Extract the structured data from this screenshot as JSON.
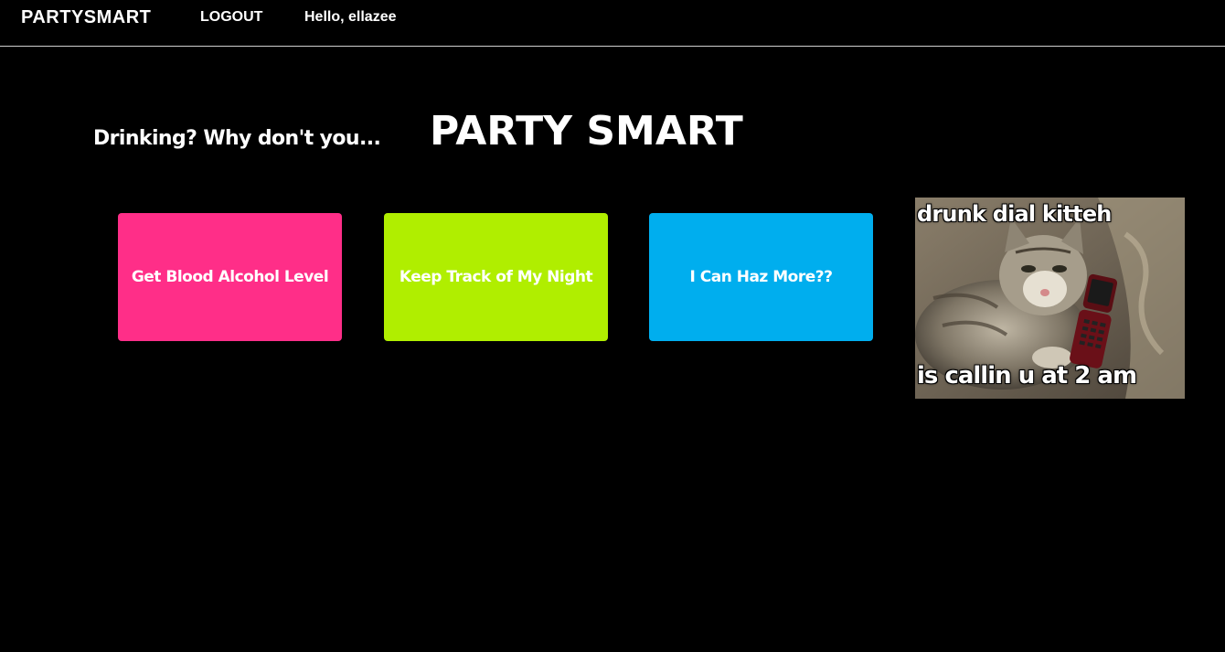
{
  "nav": {
    "brand": "PARTYSMART",
    "logout": "LOGOUT",
    "greeting": "Hello, ellazee"
  },
  "hero": {
    "tagline": "Drinking? Why don't you...",
    "title": "PARTY SMART"
  },
  "tiles": [
    {
      "label": "Get Blood Alcohol Level",
      "color": "#ff2e88"
    },
    {
      "label": "Keep Track of My Night",
      "color": "#b0ee00"
    },
    {
      "label": "I Can Haz More??",
      "color": "#00aeee"
    }
  ],
  "meme": {
    "top_caption": "drunk dial kitteh",
    "bottom_caption": "is callin u at 2 am"
  },
  "colors": {
    "background": "#000000",
    "nav_divider": "#cfcfcf",
    "text": "#ffffff"
  }
}
